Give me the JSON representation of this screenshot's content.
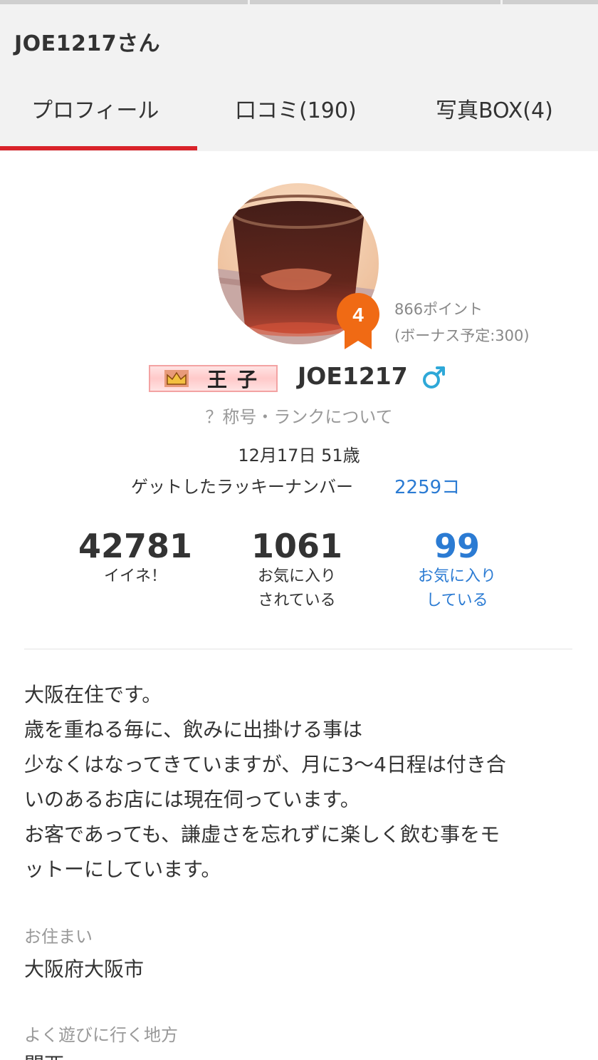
{
  "header": {
    "title": "JOE1217さん",
    "tabs": [
      {
        "label": "プロフィール",
        "active": true
      },
      {
        "label": "口コミ(190)",
        "active": false
      },
      {
        "label": "写真BOX(4)",
        "active": false
      }
    ]
  },
  "profile": {
    "rank_number": "4",
    "points": "866ポイント",
    "bonus": "(ボーナス予定:300)",
    "title_badge": "王子",
    "username": "JOE1217",
    "gender_icon": "male-icon",
    "rank_link": "？称号・ランクについて",
    "birthday": "12月17日 51歳",
    "lucky_label": "ゲットしたラッキーナンバー",
    "lucky_value": "2259コ"
  },
  "stats": {
    "likes": {
      "value": "42781",
      "label": "イイネ！"
    },
    "favorited": {
      "value": "1061",
      "label_line1": "お気に入り",
      "label_line2": "されている"
    },
    "favorites": {
      "value": "99",
      "label_line1": "お気に入り",
      "label_line2": "している"
    }
  },
  "bio": {
    "lines": [
      "大阪在住です。",
      "歳を重ねる毎に、飲みに出掛ける事は",
      "少なくはなってきていますが、月に3〜4日程は付き合",
      "いのあるお店には現在伺っています。",
      "お客であっても、謙虚さを忘れずに楽しく飲む事をモ",
      "ットーにしています。"
    ]
  },
  "details": {
    "residence_label": "お住まい",
    "residence_value": "大阪府大阪市",
    "area_label": "よく遊びに行く地方",
    "area_value": "関西"
  },
  "colors": {
    "accent_red": "#d9232a",
    "link_blue": "#2b7bd3",
    "badge_orange": "#f06a14",
    "gender_blue": "#2ea8d8",
    "header_gray": "#f2f2f2"
  }
}
